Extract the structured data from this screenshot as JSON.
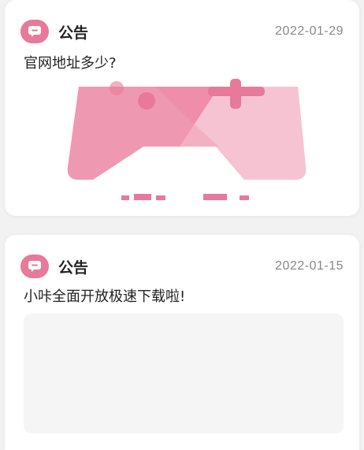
{
  "notices": [
    {
      "type_label": "公告",
      "date": "2022-01-29",
      "title": "官网地址多少?",
      "icon": "message-bubble-icon"
    },
    {
      "type_label": "公告",
      "date": "2022-01-15",
      "title": "小咔全面开放极速下载啦!",
      "icon": "message-bubble-icon"
    }
  ],
  "colors": {
    "accent": "#e7799a",
    "date_text": "#888888",
    "placeholder_bg": "#f5f5f5"
  }
}
